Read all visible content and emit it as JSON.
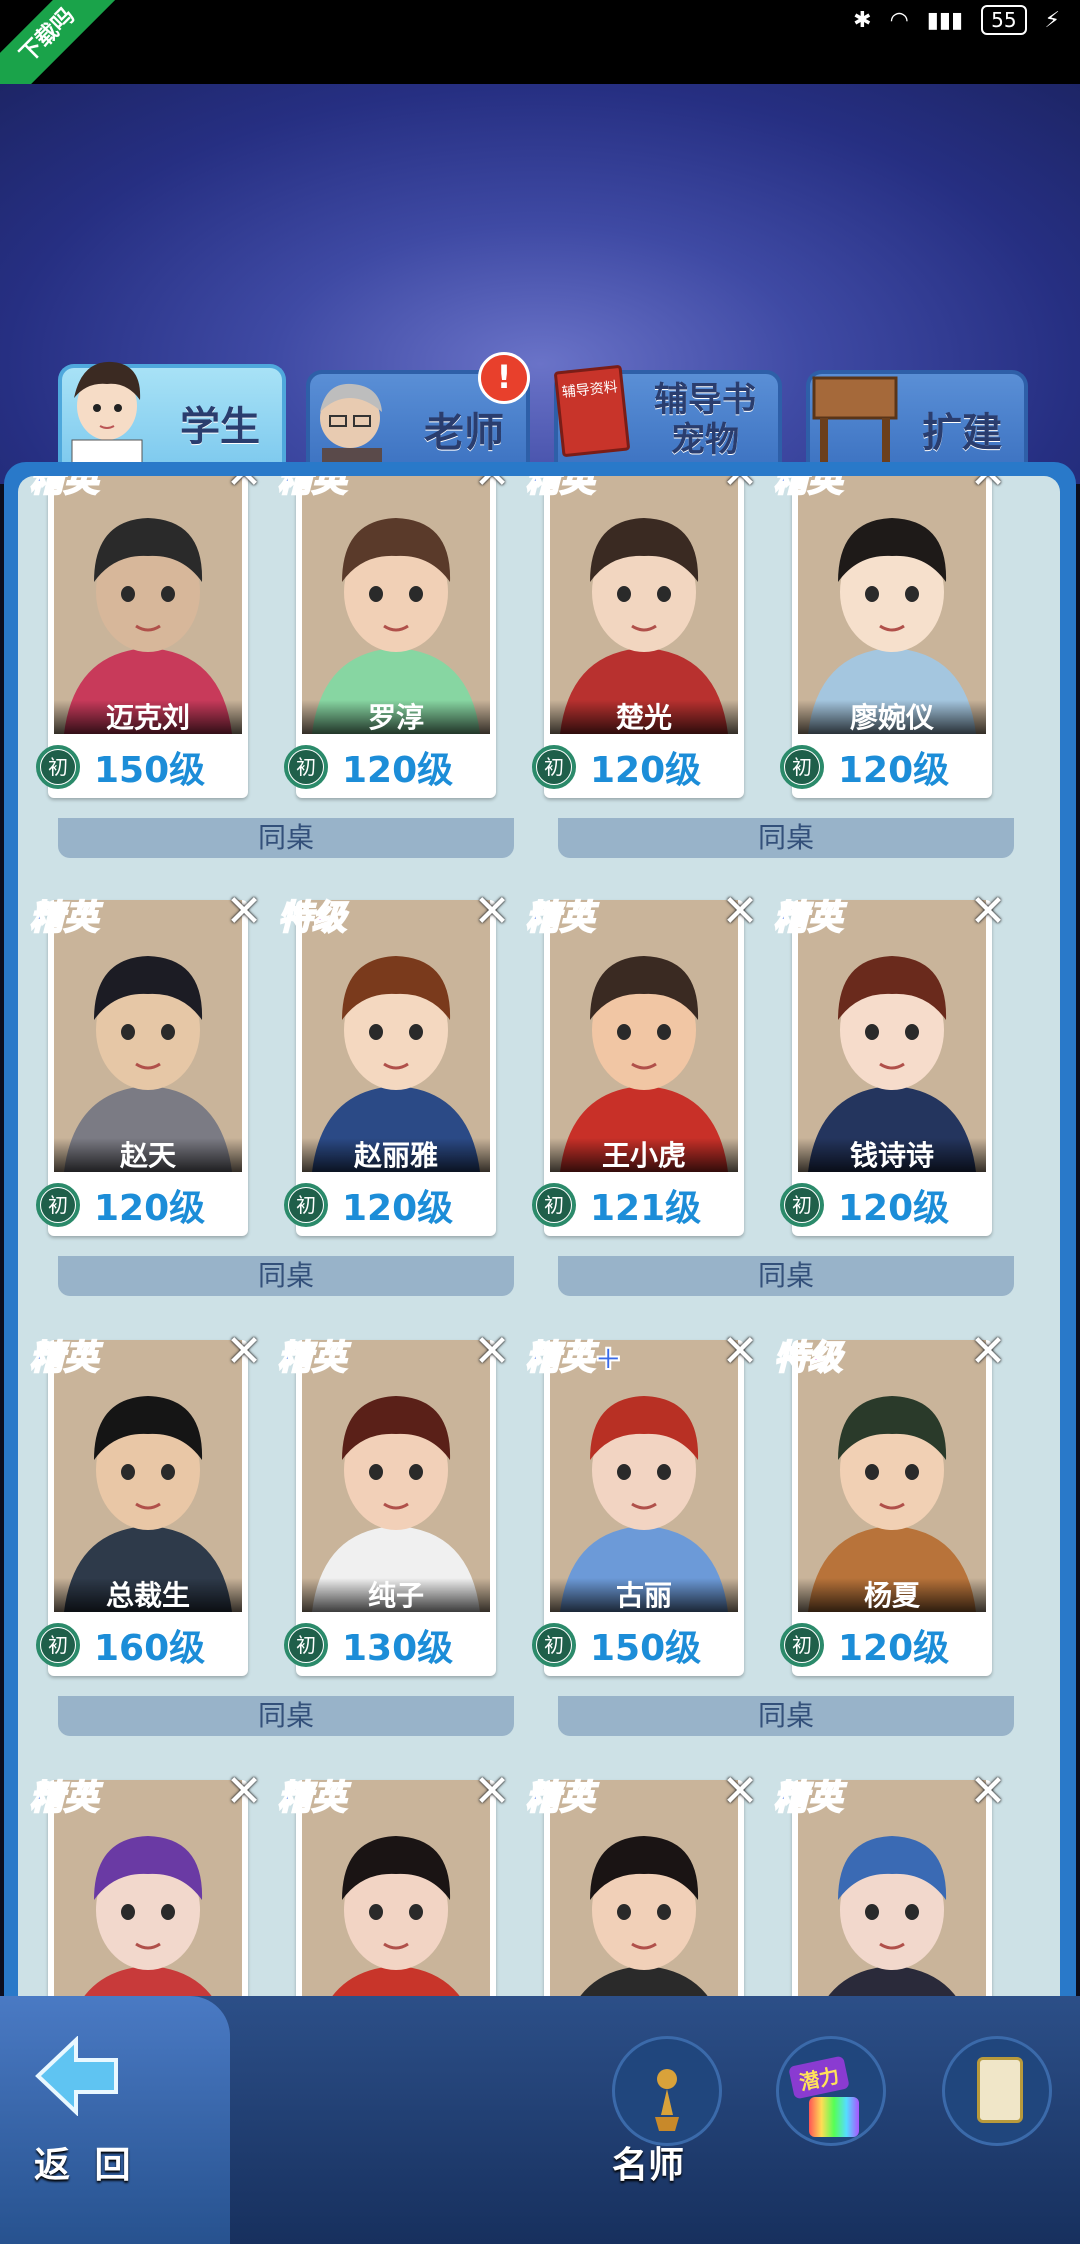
{
  "status_bar": {
    "corner_ribbon": "下载吗",
    "battery": "55"
  },
  "tabs": [
    {
      "label": "学生",
      "active": true
    },
    {
      "label": "老师",
      "active": false,
      "alert": "!"
    },
    {
      "label_line1": "辅导书",
      "label_line2": "宠物",
      "book_text": "辅导资料",
      "active": false
    },
    {
      "label": "扩建",
      "active": false
    }
  ],
  "rank_labels": {
    "elite": "精英",
    "elite_plus": "精英+",
    "special": "特级"
  },
  "level_badge": "初",
  "desk_label": "同桌",
  "rows": [
    {
      "cards": [
        {
          "rank": "精英",
          "name": "迈克刘",
          "level": "150级"
        },
        {
          "rank": "精英",
          "name": "罗淳",
          "level": "120级"
        },
        {
          "rank": "精英",
          "name": "楚光",
          "level": "120级"
        },
        {
          "rank": "精英",
          "name": "廖婉仪",
          "level": "120级"
        }
      ]
    },
    {
      "cards": [
        {
          "rank": "精英",
          "name": "赵天",
          "level": "120级"
        },
        {
          "rank": "特级",
          "name": "赵丽雅",
          "level": "120级"
        },
        {
          "rank": "精英",
          "name": "王小虎",
          "level": "121级"
        },
        {
          "rank": "精英",
          "name": "钱诗诗",
          "level": "120级"
        }
      ]
    },
    {
      "cards": [
        {
          "rank": "精英",
          "name": "总裁生",
          "level": "160级"
        },
        {
          "rank": "精英",
          "name": "纯子",
          "level": "130级"
        },
        {
          "rank": "精英+",
          "name": "古丽",
          "level": "150级"
        },
        {
          "rank": "特级",
          "name": "杨夏",
          "level": "120级"
        }
      ]
    },
    {
      "cards": [
        {
          "rank": "精英",
          "name": "",
          "level": ""
        },
        {
          "rank": "精英",
          "name": "",
          "level": ""
        },
        {
          "rank": "精英",
          "name": "",
          "level": ""
        },
        {
          "rank": "精英",
          "name": "",
          "level": ""
        }
      ]
    }
  ],
  "bottom": {
    "back_label": "返 回",
    "teacher_label": "名师",
    "potential_label": "潜力"
  },
  "colors": {
    "elite": "#3a6ae8",
    "special": "#d64ee0",
    "level_text": "#1c8dd8",
    "panel": "#2979c9"
  }
}
